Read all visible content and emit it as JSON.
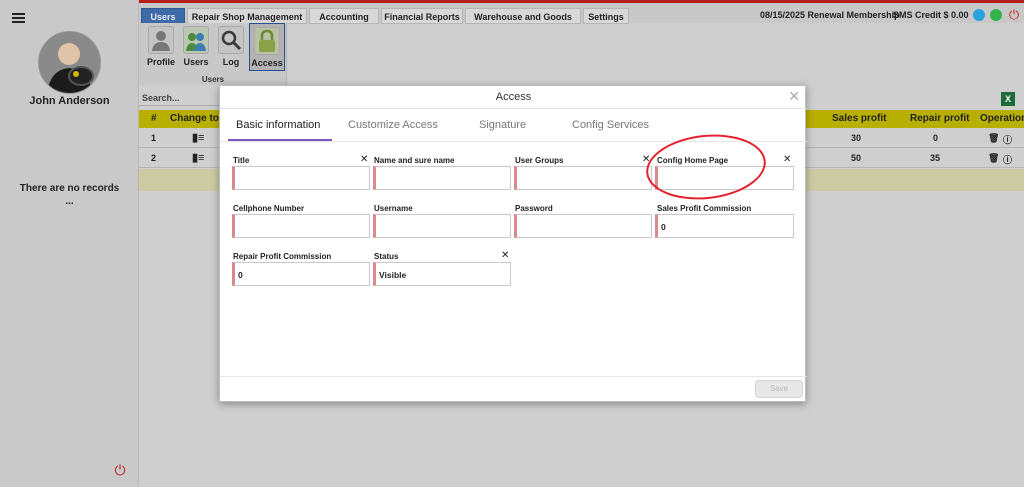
{
  "sidebar": {
    "user_name": "John Anderson",
    "no_records": "There are no records",
    "dots": "..."
  },
  "tabs": [
    {
      "label": "Users",
      "active": true
    },
    {
      "label": "Repair Shop Management",
      "active": false
    },
    {
      "label": "Accounting",
      "active": false
    },
    {
      "label": "Financial Reports",
      "active": false
    },
    {
      "label": "Warehouse and Goods",
      "active": false
    },
    {
      "label": "Settings",
      "active": false
    }
  ],
  "topbar": {
    "renewal": "08/15/2025 Renewal Membership",
    "sms": "SMS Credit $ 0.00"
  },
  "ribbon": {
    "items": [
      {
        "label": "Profile",
        "icon": "profile-icon"
      },
      {
        "label": "Users",
        "icon": "users-icon"
      },
      {
        "label": "Log",
        "icon": "log-search-icon"
      },
      {
        "label": "Access",
        "icon": "lock-icon",
        "active": true
      }
    ],
    "group": "Users"
  },
  "search": {
    "placeholder": "Search..."
  },
  "table": {
    "headers": [
      "#",
      "Change tok",
      "Sales profit",
      "Repair profit",
      "Operation"
    ],
    "rows": [
      {
        "num": "1",
        "sales": "30",
        "repair": "0"
      },
      {
        "num": "2",
        "sales": "50",
        "repair": "35"
      }
    ]
  },
  "modal": {
    "title": "Access",
    "tabs": [
      "Basic information",
      "Customize Access",
      "Signature",
      "Config Services"
    ],
    "fields": {
      "title": {
        "label": "Title",
        "value": ""
      },
      "name": {
        "label": "Name and sure name",
        "value": ""
      },
      "user_groups": {
        "label": "User Groups",
        "value": ""
      },
      "config_home": {
        "label": "Config Home Page",
        "value": ""
      },
      "cellphone": {
        "label": "Cellphone Number",
        "value": ""
      },
      "username": {
        "label": "Username",
        "value": ""
      },
      "password": {
        "label": "Password",
        "value": ""
      },
      "sales_commission": {
        "label": "Sales Profit Commission",
        "value": "0"
      },
      "repair_commission": {
        "label": "Repair Profit Commission",
        "value": "0"
      },
      "status": {
        "label": "Status",
        "value": "Visible"
      }
    },
    "save": "Save"
  },
  "colors": {
    "active_tab": "#3e6aa8",
    "table_header": "#b8b000",
    "annotation": "#e3202b",
    "tab_underline": "#7e57c2"
  }
}
